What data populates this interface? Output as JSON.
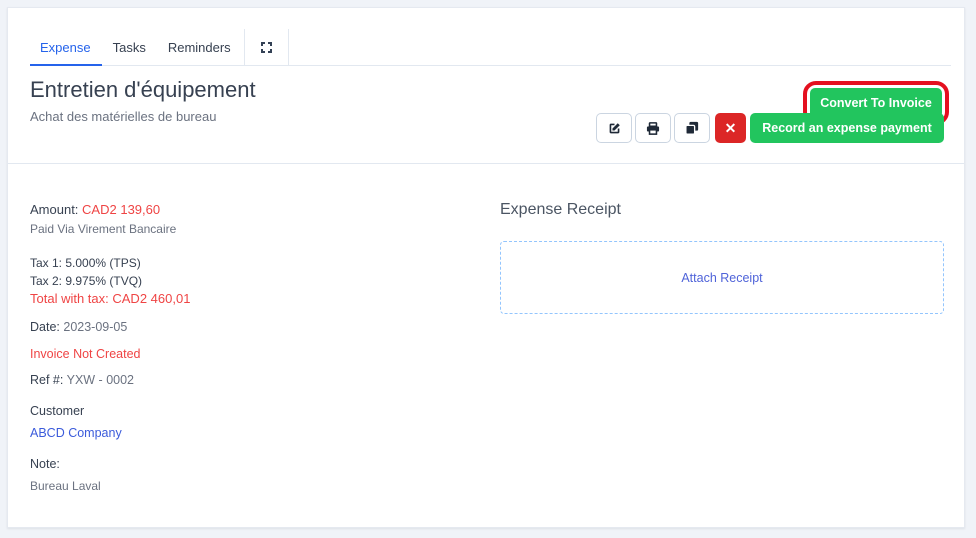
{
  "tabs": [
    {
      "label": "Expense",
      "active": true
    },
    {
      "label": "Tasks",
      "active": false
    },
    {
      "label": "Reminders",
      "active": false
    }
  ],
  "tab_expand_icon": "fullscreen-icon",
  "header": {
    "title": "Entretien d'équipement",
    "subtitle": "Achat des matérielles de bureau"
  },
  "buttons": {
    "convert": "Convert To Invoice",
    "record_payment": "Record an expense payment",
    "edit_icon": "edit-icon",
    "print_icon": "print-icon",
    "copy_icon": "copy-icon",
    "delete_glyph": "✕"
  },
  "details": {
    "amount_label": "Amount:",
    "amount_value": "CAD2 139,60",
    "paid_via": "Paid Via Virement Bancaire",
    "tax1": "Tax 1: 5.000% (TPS)",
    "tax2": "Tax 2: 9.975% (TVQ)",
    "total_with_tax": "Total with tax: CAD2 460,01",
    "date_label": "Date:",
    "date_value": "2023-09-05",
    "invoice_status": "Invoice Not Created",
    "ref_label": "Ref #:",
    "ref_value": "YXW - 0002",
    "customer_label": "Customer",
    "customer_value": "ABCD Company",
    "note_label": "Note:",
    "note_value": "Bureau Laval"
  },
  "receipt": {
    "title": "Expense Receipt",
    "attach_label": "Attach Receipt"
  },
  "colors": {
    "accent_blue": "#2563eb",
    "success_green": "#22c55e",
    "danger_red": "#dc2626",
    "highlight_ring": "#e4101f",
    "amount_red": "#ef4444"
  }
}
